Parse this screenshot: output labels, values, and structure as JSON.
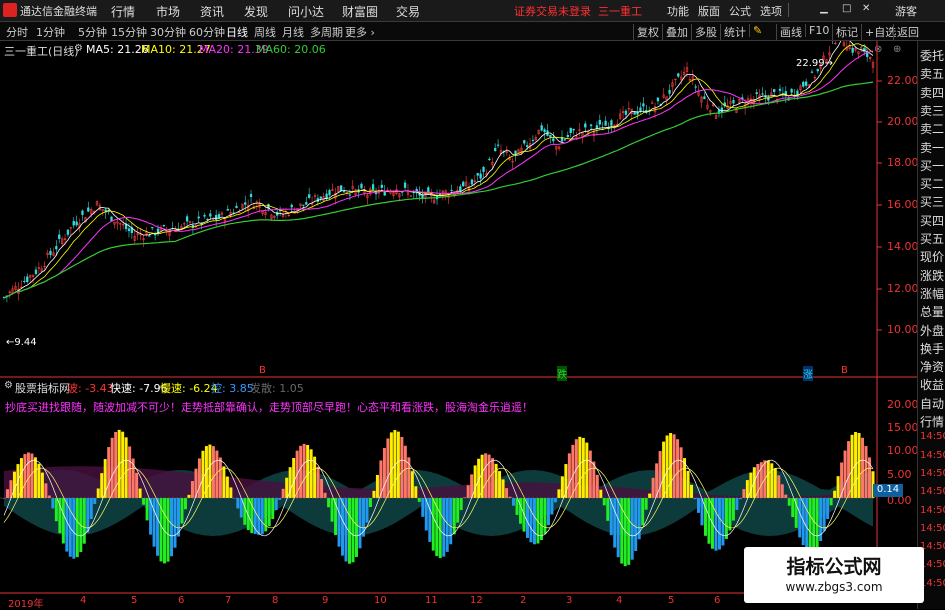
{
  "titlebar": {
    "app_title": "通达信金融终端",
    "menus": [
      "行情",
      "市场",
      "资讯",
      "发现",
      "问小达",
      "财富圈",
      "交易"
    ],
    "warning": "证券交易未登录",
    "stock_name": "三一重工",
    "right_items": [
      "功能",
      "版面",
      "公式",
      "选项"
    ],
    "guest": "游客"
  },
  "periodbar": {
    "periods": [
      "分时",
      "1分钟",
      "5分钟",
      "15分钟",
      "30分钟",
      "60分钟",
      "日线",
      "周线",
      "月线",
      "多周期",
      "更多"
    ],
    "active": "日线",
    "right_buttons": [
      "复权",
      "叠加",
      "多股",
      "统计",
      "画线",
      "F10",
      "标记",
      "+自选",
      "返回"
    ]
  },
  "main": {
    "stock_header": "三一重工(日线)",
    "ma5": "MA5: 21.26",
    "ma10": "MA10: 21.27",
    "ma20": "MA20: 21.39",
    "ma60": "MA60: 20.06",
    "high_label": "22.99",
    "low_label": "9.44",
    "b_marks": [
      "B",
      "B"
    ],
    "s_marks": [
      "跌",
      "涨"
    ],
    "colors": {
      "ma5": "#ffffff",
      "ma10": "#ffff00",
      "ma20": "#ff33ff",
      "ma60": "#33cc33",
      "axis": "#e33333"
    }
  },
  "price_axis": [
    "22.00",
    "20.00",
    "18.00",
    "16.00",
    "14.00",
    "12.00",
    "10.00"
  ],
  "indicator": {
    "name": "股票指标网",
    "fields": [
      {
        "label": "波: -3.43",
        "color": "#ff3333"
      },
      {
        "label": "快速: -7.96",
        "color": "#ffffff"
      },
      {
        "label": "慢速: -6.24",
        "color": "#ffff00"
      },
      {
        "label": "控: 3.85",
        "color": "#3399ff"
      },
      {
        "label": "发散: 1.05",
        "color": "#666666"
      }
    ],
    "slogan": "抄底买进找跟随，随波加减不可少！走势抵部靠确认，走势顶部尽早跑！心态平和看涨跌，股海淘金乐逍遥！",
    "current_value": "0.14",
    "axis": [
      "20.00",
      "15.00",
      "10.00",
      "5.00",
      "0.00"
    ]
  },
  "time_axis": [
    "2019年",
    "4",
    "5",
    "6",
    "7",
    "8",
    "9",
    "10",
    "11",
    "12",
    "2",
    "3",
    "4",
    "5",
    "6"
  ],
  "sidebar": {
    "items": [
      "委托",
      "卖五",
      "卖四",
      "卖三",
      "卖二",
      "卖一",
      "买一",
      "买二",
      "买三",
      "买四",
      "买五",
      "现价",
      "涨跌",
      "涨幅",
      "总量",
      "外盘",
      "换手",
      "净资",
      "收益",
      "自动",
      "行情",
      "14:50",
      "14:50",
      "14:50",
      "14:50",
      "14:50",
      "14:50",
      "14:50",
      "14:50",
      "14:50"
    ]
  },
  "watermark": {
    "title": "指标公式网",
    "url": "www.zbgs3.com"
  }
}
